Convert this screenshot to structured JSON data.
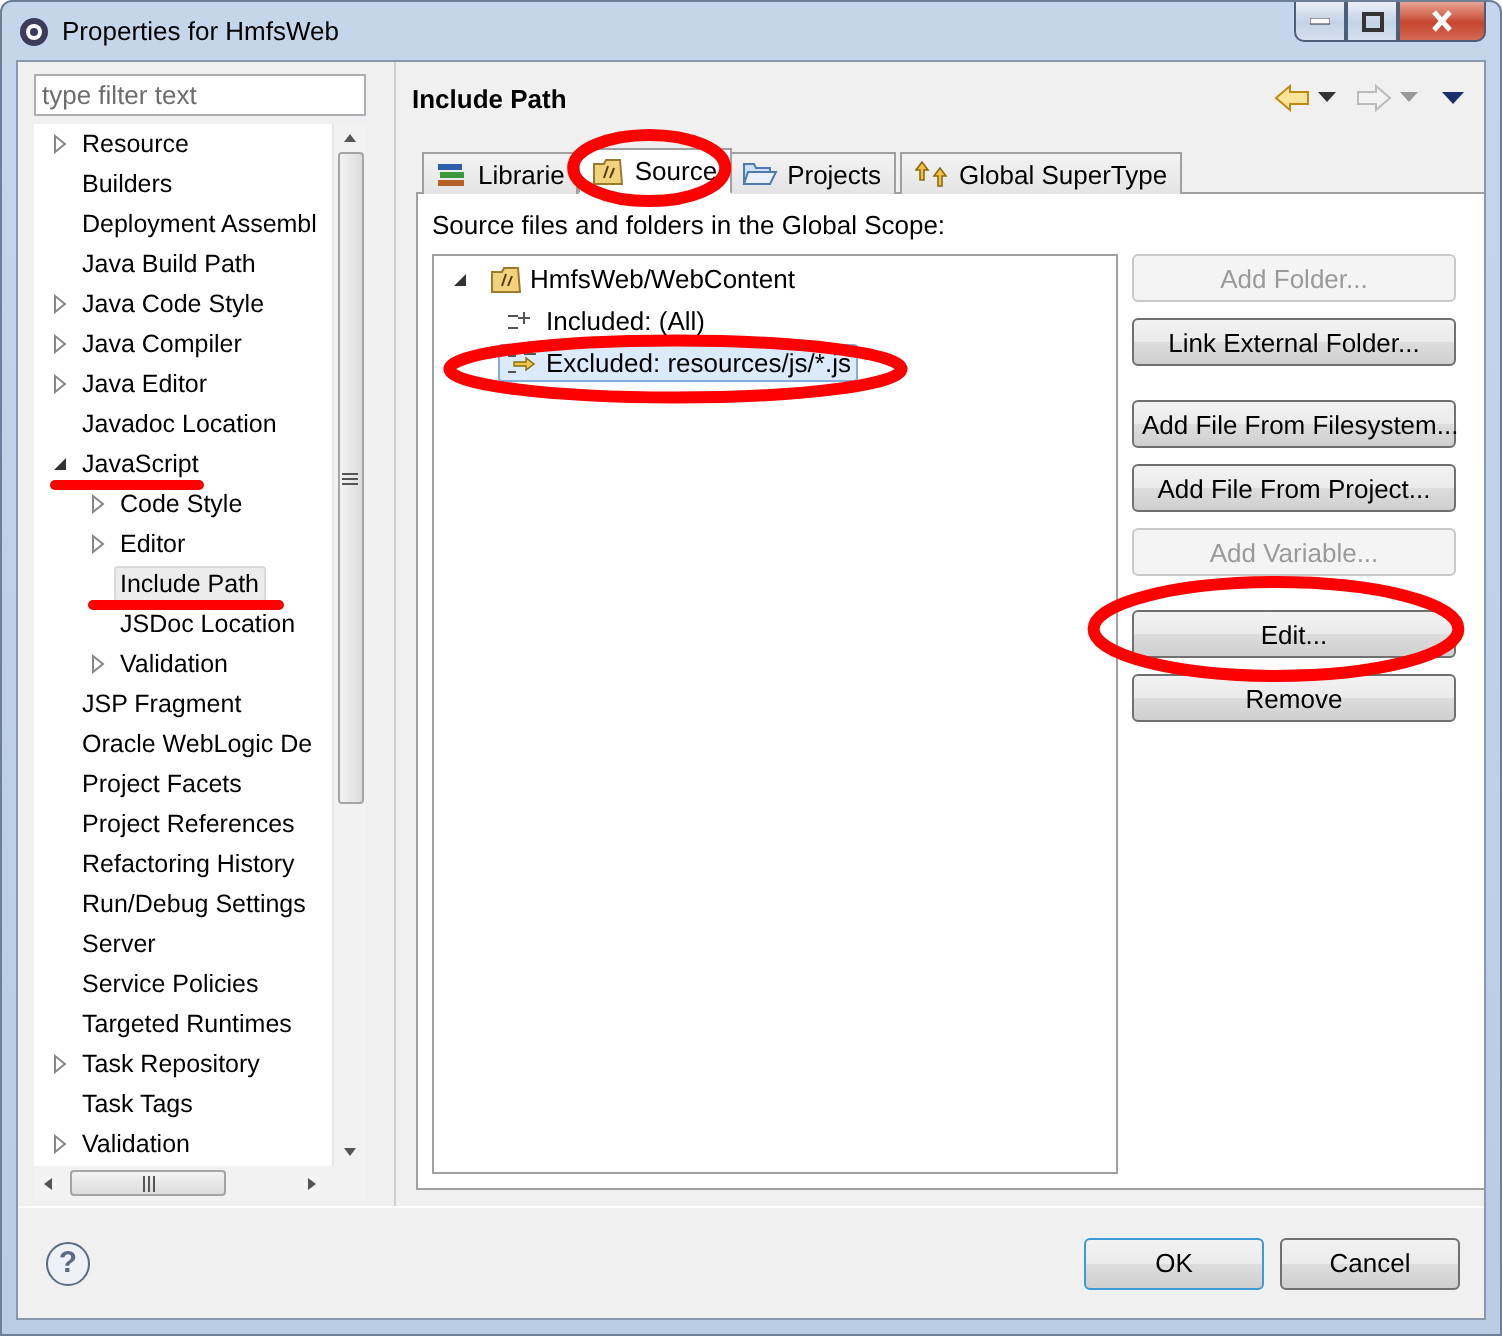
{
  "window": {
    "title": "Properties for HmfsWeb"
  },
  "filter": {
    "placeholder": "type filter text"
  },
  "sidebar": {
    "items": [
      {
        "label": "Resource",
        "kind": "group",
        "expanded": false,
        "selected": false,
        "underlined": false
      },
      {
        "label": "Builders",
        "kind": "leaf",
        "selected": false,
        "underlined": false
      },
      {
        "label": "Deployment Assembl",
        "kind": "leaf",
        "selected": false,
        "underlined": false
      },
      {
        "label": "Java Build Path",
        "kind": "leaf",
        "selected": false,
        "underlined": false
      },
      {
        "label": "Java Code Style",
        "kind": "group",
        "expanded": false,
        "selected": false,
        "underlined": false
      },
      {
        "label": "Java Compiler",
        "kind": "group",
        "expanded": false,
        "selected": false,
        "underlined": false
      },
      {
        "label": "Java Editor",
        "kind": "group",
        "expanded": false,
        "selected": false,
        "underlined": false
      },
      {
        "label": "Javadoc Location",
        "kind": "leaf",
        "selected": false,
        "underlined": false
      },
      {
        "label": "JavaScript",
        "kind": "group",
        "expanded": true,
        "selected": false,
        "underlined": true,
        "children": [
          {
            "label": "Code Style",
            "kind": "group",
            "expanded": false,
            "selected": false,
            "underlined": false
          },
          {
            "label": "Editor",
            "kind": "group",
            "expanded": false,
            "selected": false,
            "underlined": false
          },
          {
            "label": "Include Path",
            "kind": "leaf",
            "selected": true,
            "underlined": true
          },
          {
            "label": "JSDoc Location",
            "kind": "leaf",
            "selected": false,
            "underlined": false
          },
          {
            "label": "Validation",
            "kind": "group",
            "expanded": false,
            "selected": false,
            "underlined": false
          }
        ]
      },
      {
        "label": "JSP Fragment",
        "kind": "leaf",
        "selected": false,
        "underlined": false
      },
      {
        "label": "Oracle WebLogic De",
        "kind": "leaf",
        "selected": false,
        "underlined": false
      },
      {
        "label": "Project Facets",
        "kind": "leaf",
        "selected": false,
        "underlined": false
      },
      {
        "label": "Project References",
        "kind": "leaf",
        "selected": false,
        "underlined": false
      },
      {
        "label": "Refactoring History",
        "kind": "leaf",
        "selected": false,
        "underlined": false
      },
      {
        "label": "Run/Debug Settings",
        "kind": "leaf",
        "selected": false,
        "underlined": false
      },
      {
        "label": "Server",
        "kind": "leaf",
        "selected": false,
        "underlined": false
      },
      {
        "label": "Service Policies",
        "kind": "leaf",
        "selected": false,
        "underlined": false
      },
      {
        "label": "Targeted Runtimes",
        "kind": "leaf",
        "selected": false,
        "underlined": false
      },
      {
        "label": "Task Repository",
        "kind": "group",
        "expanded": false,
        "selected": false,
        "underlined": false
      },
      {
        "label": "Task Tags",
        "kind": "leaf",
        "selected": false,
        "underlined": false
      },
      {
        "label": "Validation",
        "kind": "group",
        "expanded": false,
        "selected": false,
        "underlined": false
      }
    ]
  },
  "panel": {
    "title": "Include Path",
    "tabs": [
      {
        "label": "Librarie",
        "kind": "library",
        "selected": false,
        "circled": false
      },
      {
        "label": "Source",
        "kind": "source",
        "selected": true,
        "circled": true
      },
      {
        "label": "Projects",
        "kind": "project",
        "selected": false,
        "circled": false
      },
      {
        "label": "Global SuperType",
        "kind": "supertype",
        "selected": false,
        "circled": false
      }
    ],
    "caption": "Source files and folders in the Global Scope:",
    "tree": [
      {
        "label": "HmfsWeb/WebContent",
        "expanded": true,
        "children": [
          {
            "label": "Included: (All)",
            "kind": "included",
            "selected": false,
            "circled": false
          },
          {
            "label": "Excluded: resources/js/*.js",
            "kind": "excluded",
            "selected": true,
            "circled": true
          }
        ]
      }
    ],
    "button_groups": [
      [
        {
          "label": "Add Folder...",
          "disabled": true,
          "circled": false
        },
        {
          "label": "Link External Folder...",
          "disabled": false,
          "circled": false
        }
      ],
      [
        {
          "label": "Add File From Filesystem...",
          "disabled": false,
          "circled": false
        },
        {
          "label": "Add File From Project...",
          "disabled": false,
          "circled": false
        },
        {
          "label": "Add Variable...",
          "disabled": true,
          "circled": false
        }
      ],
      [
        {
          "label": "Edit...",
          "disabled": false,
          "circled": true
        },
        {
          "label": "Remove",
          "disabled": false,
          "circled": false
        }
      ]
    ]
  },
  "footer": {
    "help": "?",
    "buttons": [
      {
        "label": "OK",
        "default": true
      },
      {
        "label": "Cancel",
        "default": false
      }
    ]
  }
}
